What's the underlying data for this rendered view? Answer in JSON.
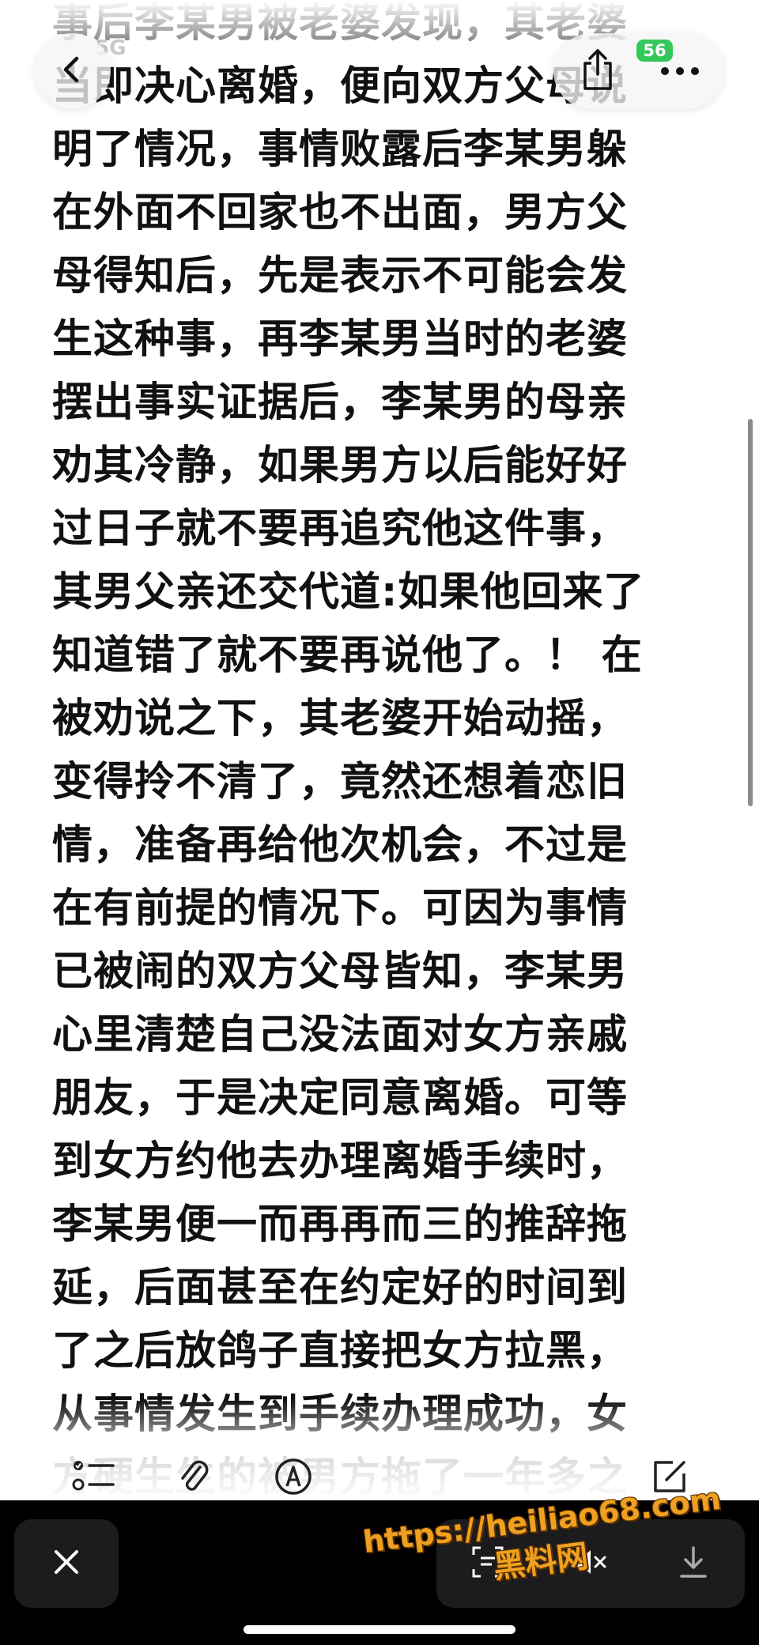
{
  "note": {
    "lines": [
      "事后李某男被老婆发现，其老婆",
      "当即决心离婚，便向双方父母说",
      "明了情况，事情败露后李某男躲",
      "在外面不回家也不出面，男方父",
      "母得知后，先是表示不可能会发",
      "生这种事，再李某男当时的老婆",
      "摆出事实证据后，李某男的母亲",
      "劝其冷静，如果男方以后能好好",
      "过日子就不要再追究他这件事，",
      "其男父亲还交代道:如果他回来了",
      "知道错了就不要再说他了。！ 在",
      "被劝说之下，其老婆开始动摇，",
      "变得拎不清了，竟然还想着恋旧",
      "情，准备再给他次机会，不过是",
      "在有前提的情况下。可因为事情",
      "已被闹的双方父母皆知，李某男",
      "心里清楚自己没法面对女方亲戚",
      "朋友，于是决定同意离婚。可等",
      "到女方约他去办理离婚手续时，",
      "李某男便一而再再而三的推辞拖",
      "延，后面甚至在约定好的时间到",
      "了之后放鸽子直接把女方拉黑，",
      "从事情发生到手续办理成功，女",
      "方硬生生的被男方拖了一年多之"
    ]
  },
  "status_bar": {
    "signal_text": "5G",
    "battery": "56"
  },
  "header": {
    "back_icon": "chevron-left-icon",
    "share_icon": "share-icon",
    "more_icon": "ellipsis-icon"
  },
  "note_toolbar": {
    "icons": [
      "checklist-icon",
      "paperclip-icon",
      "pen-markup-icon",
      "compose-icon"
    ]
  },
  "viewer_bar": {
    "close_icon": "close-icon",
    "live_text_icon": "live-text-icon",
    "mute_icon": "speaker-muted-icon",
    "download_icon": "download-icon"
  },
  "watermark": {
    "url": "https://heiliao68.com",
    "name": "黑料网"
  },
  "colors": {
    "battery_green": "#34c759",
    "watermark_orange": "#f0a020",
    "viewer_bar_bg": "#000000"
  }
}
